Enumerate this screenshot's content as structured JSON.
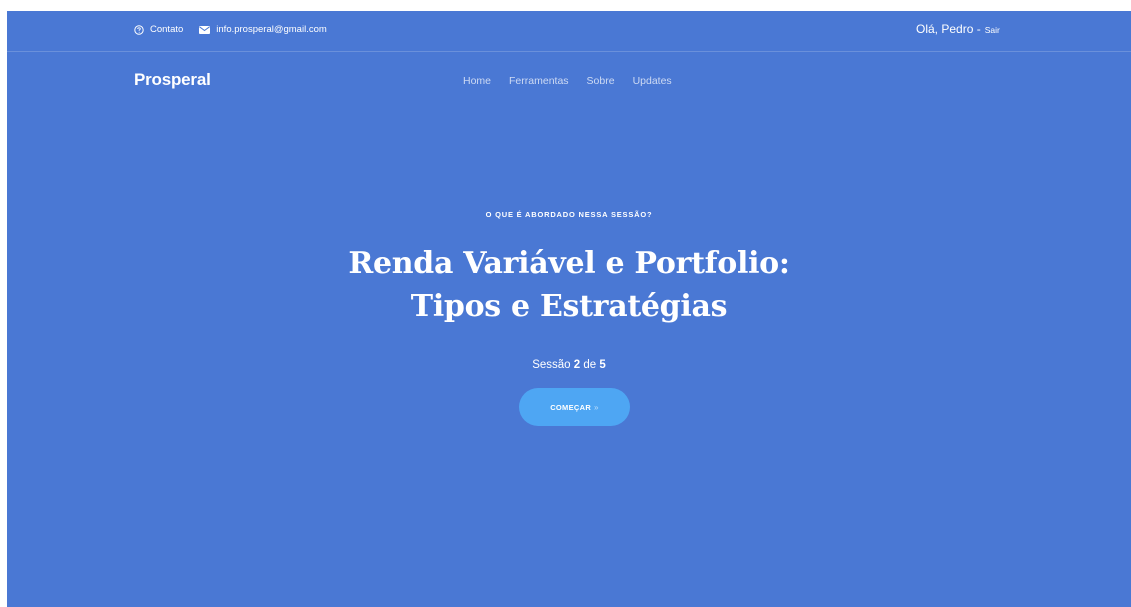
{
  "topbar": {
    "contact_label": "Contato",
    "email": "info.prosperal@gmail.com",
    "greeting": "Olá, Pedro -",
    "logout_label": "Sair"
  },
  "nav": {
    "brand": "Prosperal",
    "items": [
      {
        "label": "Home"
      },
      {
        "label": "Ferramentas"
      },
      {
        "label": "Sobre"
      },
      {
        "label": "Updates"
      }
    ]
  },
  "hero": {
    "eyebrow": "O QUE É ABORDADO NESSA SESSÃO?",
    "title_line1": "Renda Variável e Portfolio:",
    "title_line2": "Tipos e Estratégias",
    "session_prefix": "Sessão",
    "session_current": "2",
    "session_mid": "de",
    "session_total": "5",
    "cta_label": "COMEÇAR",
    "cta_icon": "chevron-right-double-icon"
  },
  "colors": {
    "background": "#4a78d4",
    "cta": "#4ea6f3",
    "text": "#ffffff"
  }
}
